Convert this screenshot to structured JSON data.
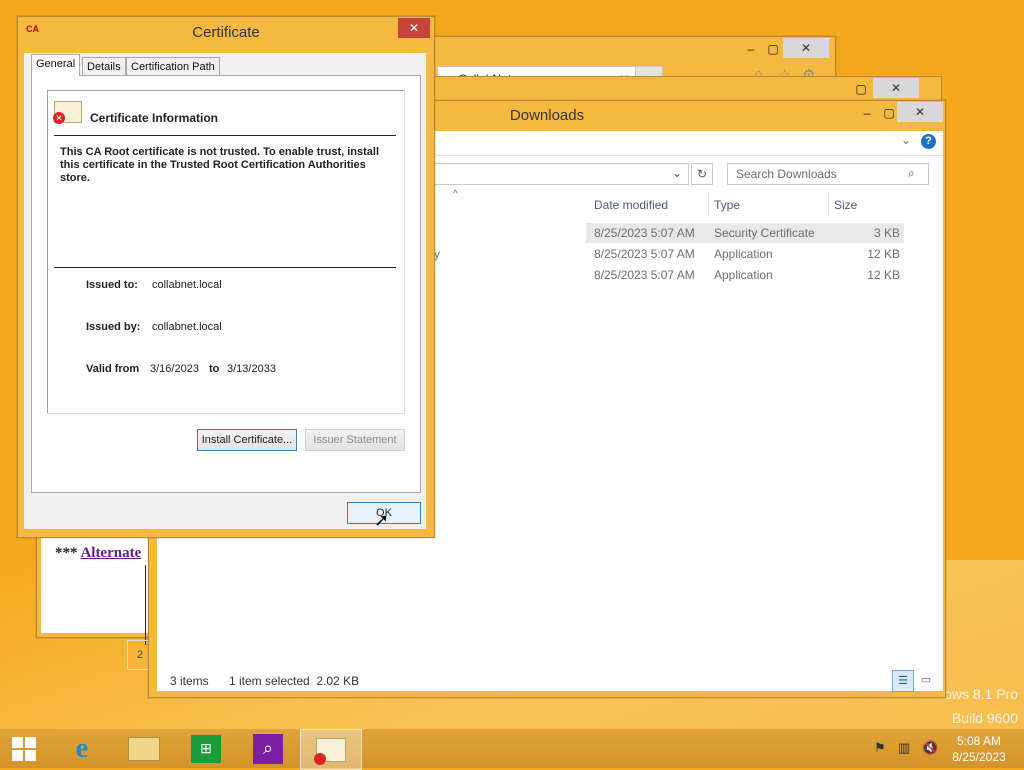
{
  "colors": {
    "desktop": "#f4a81c",
    "frame": "#f6b93f",
    "close": "#c7443a",
    "link": "#6a1a8a"
  },
  "desktop": {
    "watermark_line1": "ows 8.1 Pro",
    "watermark_line2": "Build 9600"
  },
  "browser": {
    "tab_title": "CollabNet",
    "page_text_prefix": "*** ",
    "page_link": "Alternate",
    "page_partial": "2"
  },
  "explorer": {
    "title": "Downloads",
    "search_placeholder": "Search Downloads",
    "columns": [
      "Date modified",
      "Type",
      "Size"
    ],
    "rows": [
      {
        "date": "8/25/2023 5:07 AM",
        "type": "Security Certificate",
        "size": "3 KB",
        "name_partial": ""
      },
      {
        "date": "8/25/2023 5:07 AM",
        "type": "Application",
        "size": "12 KB",
        "name_partial": "y"
      },
      {
        "date": "8/25/2023 5:07 AM",
        "type": "Application",
        "size": "12 KB",
        "name_partial": ""
      }
    ],
    "status_count": "3 items",
    "status_selected": "1 item selected  2.02 KB"
  },
  "certificate": {
    "title": "Certificate",
    "tabs": [
      "General",
      "Details",
      "Certification Path"
    ],
    "info_heading": "Certificate Information",
    "warning": "This CA Root certificate is not trusted. To enable trust, install this certificate in the Trusted Root Certification Authorities store.",
    "issued_to_label": "Issued to:",
    "issued_to": "collabnet.local",
    "issued_by_label": "Issued by:",
    "issued_by": "collabnet.local",
    "valid_from_label": "Valid from",
    "valid_from": "3/16/2023",
    "valid_to_label": "to",
    "valid_to": "3/13/2033",
    "install_button": "Install Certificate...",
    "issuer_button": "Issuer Statement",
    "ok_button": "OK",
    "icon_label": "CA"
  },
  "taskbar": {
    "time": "5:08 AM",
    "date": "8/25/2023",
    "icons": [
      "start-icon",
      "internet-explorer-icon",
      "file-explorer-icon",
      "store-icon",
      "search-app-icon",
      "certificate-app-icon"
    ]
  }
}
